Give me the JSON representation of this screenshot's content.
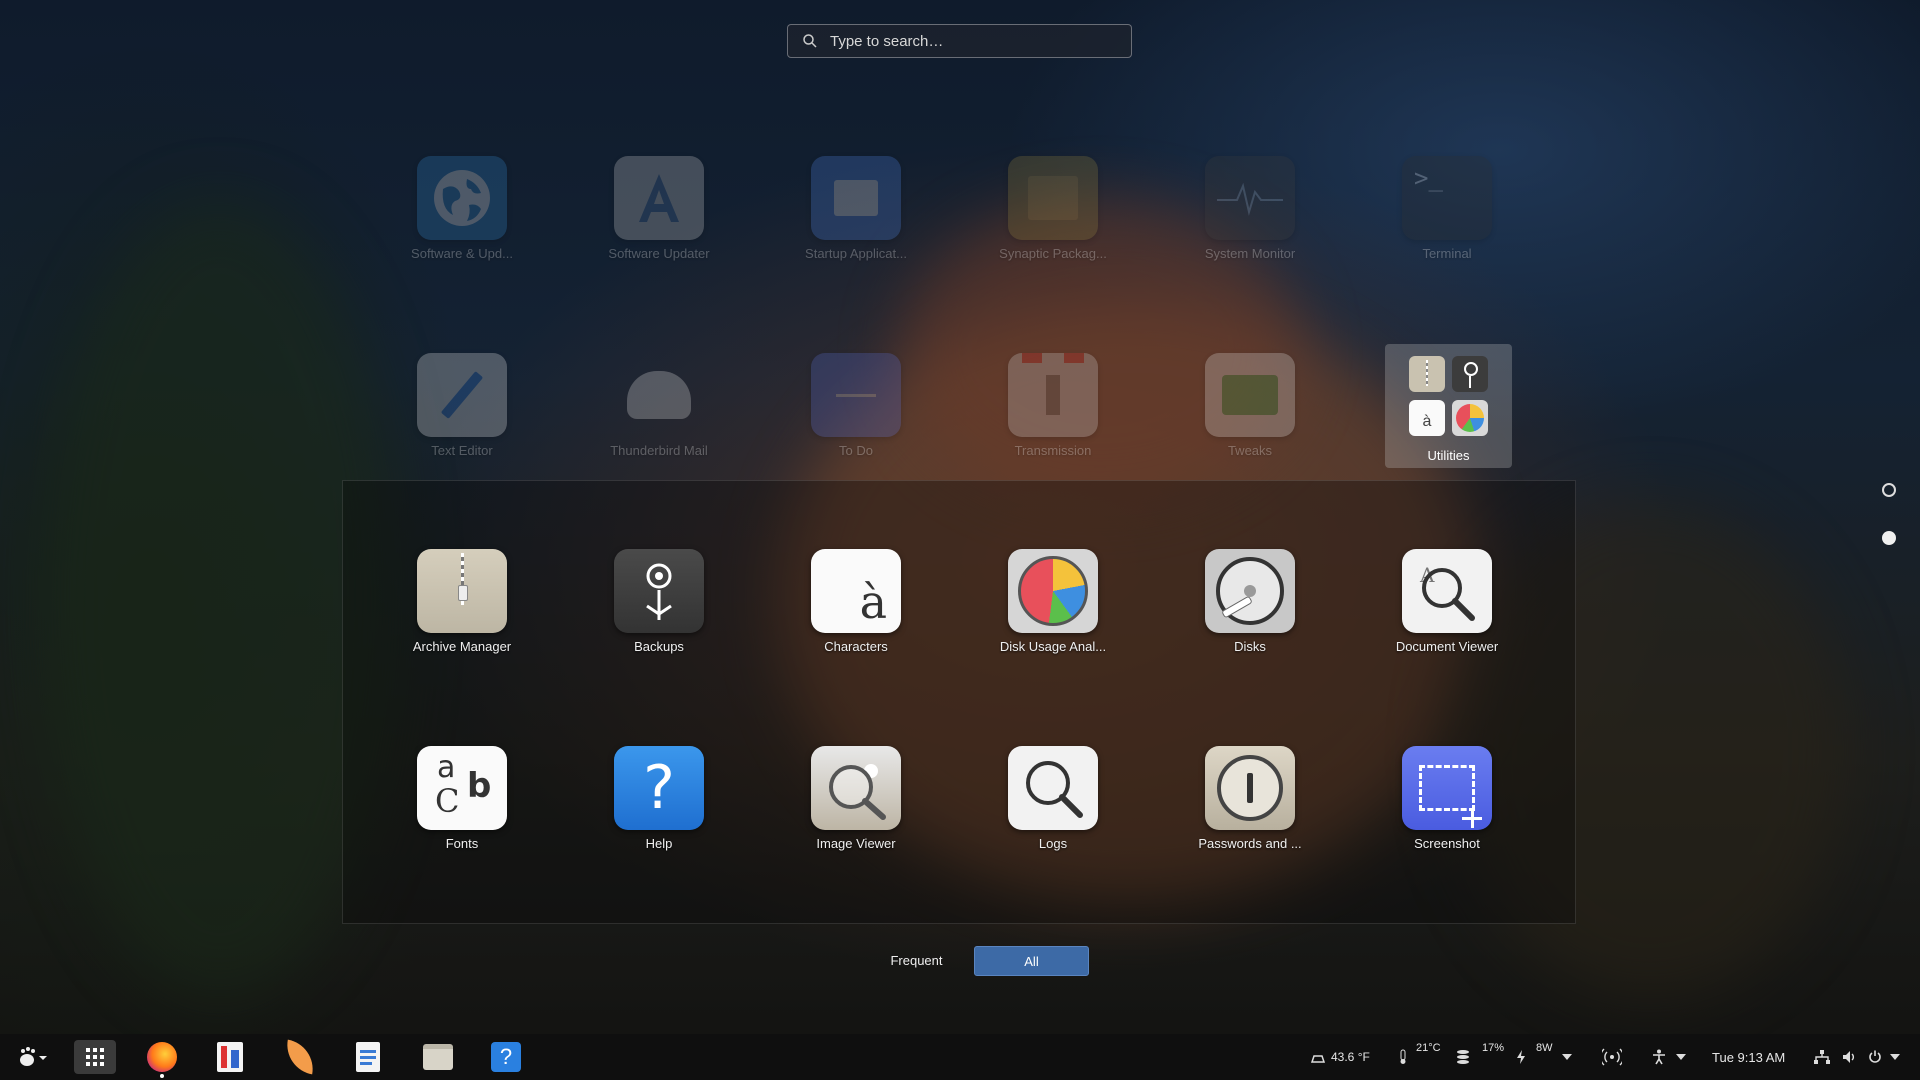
{
  "search": {
    "placeholder": "Type to search…"
  },
  "apps_row1": [
    {
      "label": "Software & Upd...",
      "icon": "globe-icon"
    },
    {
      "label": "Software Updater",
      "icon": "software-updater-icon"
    },
    {
      "label": "Startup Applicat...",
      "icon": "startup-applications-icon"
    },
    {
      "label": "Synaptic Packag...",
      "icon": "synaptic-icon"
    },
    {
      "label": "System Monitor",
      "icon": "system-monitor-icon"
    },
    {
      "label": "Terminal",
      "icon": "terminal-icon"
    }
  ],
  "apps_row2": [
    {
      "label": "Text Editor",
      "icon": "text-editor-icon"
    },
    {
      "label": "Thunderbird Mail",
      "icon": "thunderbird-icon"
    },
    {
      "label": "To Do",
      "icon": "todo-icon"
    },
    {
      "label": "Transmission",
      "icon": "transmission-icon"
    },
    {
      "label": "Tweaks",
      "icon": "tweaks-icon"
    }
  ],
  "utilities_folder": {
    "label": "Utilities"
  },
  "folder_row1": [
    {
      "label": "Archive Manager",
      "icon": "archive-manager-icon"
    },
    {
      "label": "Backups",
      "icon": "backups-icon"
    },
    {
      "label": "Characters",
      "icon": "characters-icon"
    },
    {
      "label": "Disk Usage Anal...",
      "icon": "disk-usage-icon"
    },
    {
      "label": "Disks",
      "icon": "disks-icon"
    },
    {
      "label": "Document Viewer",
      "icon": "document-viewer-icon"
    }
  ],
  "folder_row2": [
    {
      "label": "Fonts",
      "icon": "fonts-icon"
    },
    {
      "label": "Help",
      "icon": "help-icon"
    },
    {
      "label": "Image Viewer",
      "icon": "image-viewer-icon"
    },
    {
      "label": "Logs",
      "icon": "logs-icon"
    },
    {
      "label": "Passwords and ...",
      "icon": "passwords-icon"
    },
    {
      "label": "Screenshot",
      "icon": "screenshot-icon"
    }
  ],
  "characters_glyph": "à",
  "terminal_glyph": ">_",
  "fonts_glyphs": {
    "a": "a",
    "c": "C",
    "b": "b"
  },
  "help_glyph": "?",
  "switcher": {
    "frequent": "Frequent",
    "all": "All",
    "active": "All"
  },
  "taskbar": {
    "weather": "43.6 °F",
    "cpu_temp": "21°C",
    "memory": "17%",
    "power": "8W",
    "clock": "Tue  9:13 AM"
  },
  "colors": {
    "accent": "#3d6aa6",
    "taskbar": "#0f0f0f"
  }
}
